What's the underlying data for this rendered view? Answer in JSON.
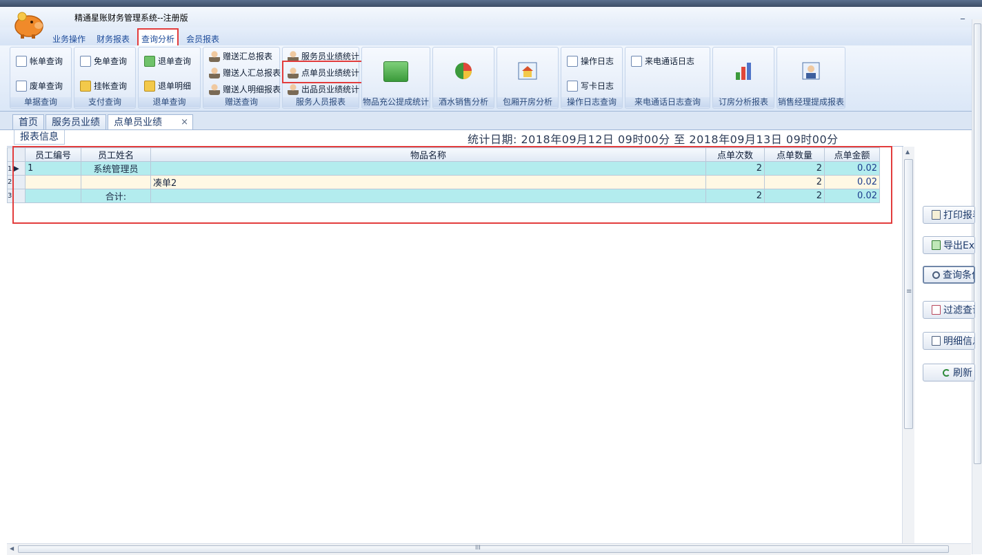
{
  "window": {
    "title": "精通星账财务管理系统--注册版",
    "minimize_glyph": "_"
  },
  "menu": {
    "tabs": [
      {
        "label": "业务操作"
      },
      {
        "label": "财务报表"
      },
      {
        "label": "查询分析"
      },
      {
        "label": "会员报表"
      }
    ],
    "active": "查询分析"
  },
  "ribbon": {
    "groups": [
      {
        "label": "单据查询",
        "items": [
          "帐单查询",
          "废单查询"
        ]
      },
      {
        "label": "支付查询",
        "items": [
          "免单查询",
          "挂帐查询"
        ]
      },
      {
        "label": "退单查询",
        "items": [
          "退单查询",
          "退单明细"
        ]
      },
      {
        "label": "赠送查询",
        "items": [
          "赠送汇总报表",
          "赠送人汇总报表",
          "赠送人明细报表"
        ]
      },
      {
        "label": "服务人员报表",
        "items": [
          "服务员业绩统计",
          "点单员业绩统计",
          "出品员业绩统计"
        ]
      },
      {
        "label": "物品充公提成统计"
      },
      {
        "label": "酒水销售分析"
      },
      {
        "label": "包厢开房分析"
      },
      {
        "label": "操作日志查询",
        "items": [
          "操作日志",
          "写卡日志"
        ]
      },
      {
        "label": "来电通话日志查询",
        "items": [
          "来电通话日志"
        ]
      },
      {
        "label": "订房分析报表"
      },
      {
        "label": "销售经理提成报表"
      }
    ]
  },
  "doc_tabs": [
    {
      "label": "首页"
    },
    {
      "label": "服务员业绩"
    },
    {
      "label": "点单员业绩",
      "close": "×"
    }
  ],
  "report": {
    "info_tab": "报表信息",
    "date_line": "统计日期: 2018年09月12日  09时00分  至  2018年09月13日  09时00分"
  },
  "grid": {
    "columns": [
      "员工编号",
      "员工姓名",
      "物品名称",
      "点单次数",
      "点单数量",
      "点单金额"
    ],
    "rows": [
      {
        "index": "1",
        "marker": "▶",
        "id": "1",
        "name": "系统管理员",
        "item": "",
        "times": "2",
        "qty": "2",
        "amount": "0.02"
      },
      {
        "index": "2",
        "marker": "",
        "id": "",
        "name": "",
        "item": "凑单2",
        "times": "",
        "qty": "2",
        "amount": "0.02"
      },
      {
        "index": "3",
        "marker": "",
        "id": "",
        "name": "合计:",
        "item": "",
        "times": "2",
        "qty": "2",
        "amount": "0.02"
      }
    ]
  },
  "side_buttons": [
    {
      "label": "打印报表",
      "icon": "printer-icon"
    },
    {
      "label": "导出Excel",
      "icon": "export-excel-icon"
    },
    {
      "label": "查询条件",
      "icon": "magnifier-icon"
    },
    {
      "label": "过滤查询",
      "icon": "chart-filter-icon"
    },
    {
      "label": "明细信息",
      "icon": "document-icon"
    },
    {
      "label": "刷新",
      "icon": "refresh-icon"
    }
  ],
  "scroll": {
    "v_grip": "≡",
    "h_grip": "III"
  },
  "colors": {
    "highlight": "#e23b3b",
    "row_cyan": "#b3ecee",
    "row_cream": "#fff8e4",
    "ribbon_bg": "#dbe7f7"
  }
}
